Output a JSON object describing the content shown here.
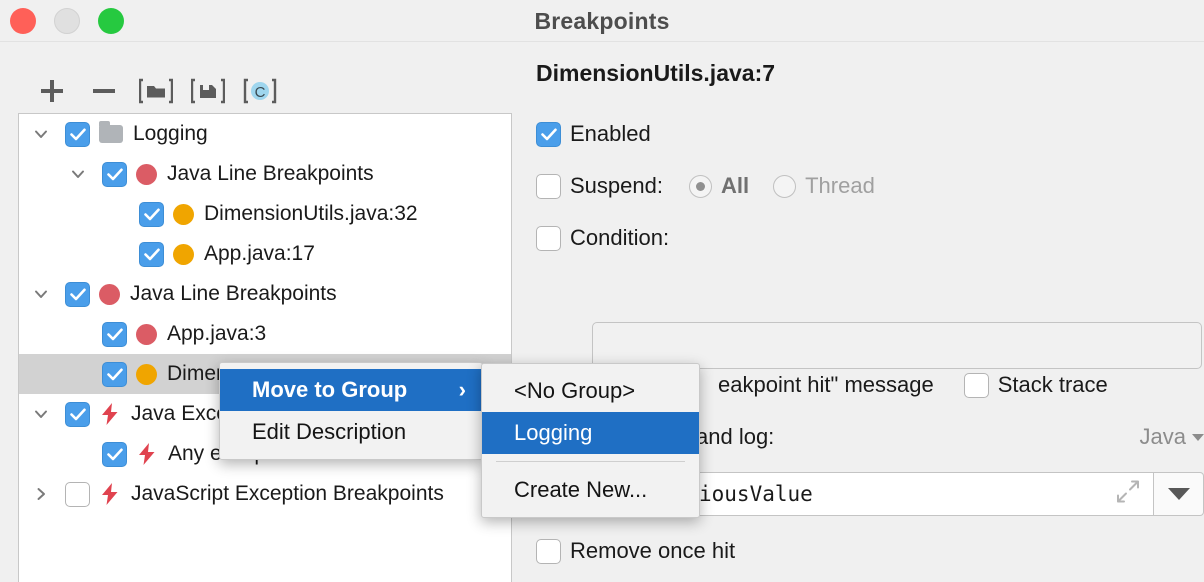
{
  "window": {
    "title": "Breakpoints",
    "controls": [
      "close-button",
      "minimize-button",
      "zoom-button"
    ]
  },
  "toolbar": {
    "buttons": [
      {
        "name": "add-breakpoint-button",
        "icon": "plus-icon",
        "label": "+"
      },
      {
        "name": "remove-breakpoint-button",
        "icon": "minus-icon",
        "label": "−"
      },
      {
        "name": "move-to-group-button",
        "icon": "folder-brackets-icon",
        "label": ""
      },
      {
        "name": "save-to-group-button",
        "icon": "disk-brackets-icon",
        "label": ""
      },
      {
        "name": "class-filter-button",
        "icon": "c-circle-icon",
        "label": "C",
        "active": true
      }
    ]
  },
  "tree": {
    "rows": [
      {
        "label": "Logging",
        "indent": 0,
        "twisty": "down",
        "checked": true,
        "icon": "folder-icon",
        "selected": false
      },
      {
        "label": "Java Line Breakpoints",
        "indent": 1,
        "twisty": "down",
        "checked": true,
        "icon": "red-circle-icon",
        "selected": false
      },
      {
        "label": "DimensionUtils.java:32",
        "indent": 2,
        "twisty": "none",
        "checked": true,
        "icon": "orange-circle-icon",
        "selected": false
      },
      {
        "label": "App.java:17",
        "indent": 2,
        "twisty": "none",
        "checked": true,
        "icon": "orange-circle-icon",
        "selected": false
      },
      {
        "label": "Java Line Breakpoints",
        "indent": 0,
        "twisty": "down",
        "checked": true,
        "icon": "red-circle-icon",
        "selected": false
      },
      {
        "label": "App.java:3",
        "indent": 1,
        "twisty": "none",
        "checked": true,
        "icon": "red-circle-icon",
        "selected": false
      },
      {
        "label": "DimensionUtils.java:7",
        "indent": 1,
        "twisty": "none",
        "checked": true,
        "icon": "orange-circle-icon",
        "selected": true
      },
      {
        "label": "Java Exception Breakpoints",
        "indent": 0,
        "twisty": "down",
        "checked": true,
        "icon": "lightning-icon",
        "selected": false
      },
      {
        "label": "Any exception",
        "indent": 1,
        "twisty": "none",
        "checked": true,
        "icon": "lightning-icon",
        "selected": false
      },
      {
        "label": "JavaScript Exception Breakpoints",
        "indent": 0,
        "twisty": "right",
        "checked": false,
        "icon": "lightning-icon",
        "selected": false
      }
    ]
  },
  "detail": {
    "title": "DimensionUtils.java:7",
    "enabled_label": "Enabled",
    "enabled_checked": true,
    "suspend_label": "Suspend:",
    "suspend_checked": false,
    "suspend_options": [
      {
        "label": "All",
        "selected": true
      },
      {
        "label": "Thread",
        "selected": false
      }
    ],
    "condition_label": "Condition:",
    "condition_checked": false,
    "condition_value": "",
    "log_message_label": "“Breakpoint hit” message",
    "log_message_visible_text": "eakpoint hit\" message",
    "stack_trace_label": "Stack trace",
    "stack_trace_checked": false,
    "evaluate_label": "Evaluate and log:",
    "evaluate_visible_text": "and log:",
    "language_value": "Java",
    "expression_value": "previousValue",
    "expression_visible_text": "iousValue",
    "remove_once_hit_label": "Remove once hit",
    "remove_once_hit_checked": false
  },
  "context_menu": {
    "items": [
      {
        "label": "Move to Group",
        "highlighted": true,
        "submenu": true,
        "arrow": "›"
      },
      {
        "label": "Edit Description",
        "highlighted": false,
        "submenu": false,
        "arrow": ""
      }
    ]
  },
  "submenu": {
    "items": [
      {
        "label": "<No Group>",
        "highlighted": false,
        "separator_after": false
      },
      {
        "label": "Logging",
        "highlighted": true,
        "separator_after": true
      },
      {
        "label": "Create New...",
        "highlighted": false,
        "separator_after": false
      }
    ]
  },
  "colors": {
    "accent_blue": "#1f6fc4",
    "checkbox_blue": "#4a9eea",
    "breakpoint_red": "#db5c65",
    "breakpoint_orange": "#f0a500",
    "lightning_red": "#e0434f",
    "selection_gray": "#d2d2d2"
  }
}
